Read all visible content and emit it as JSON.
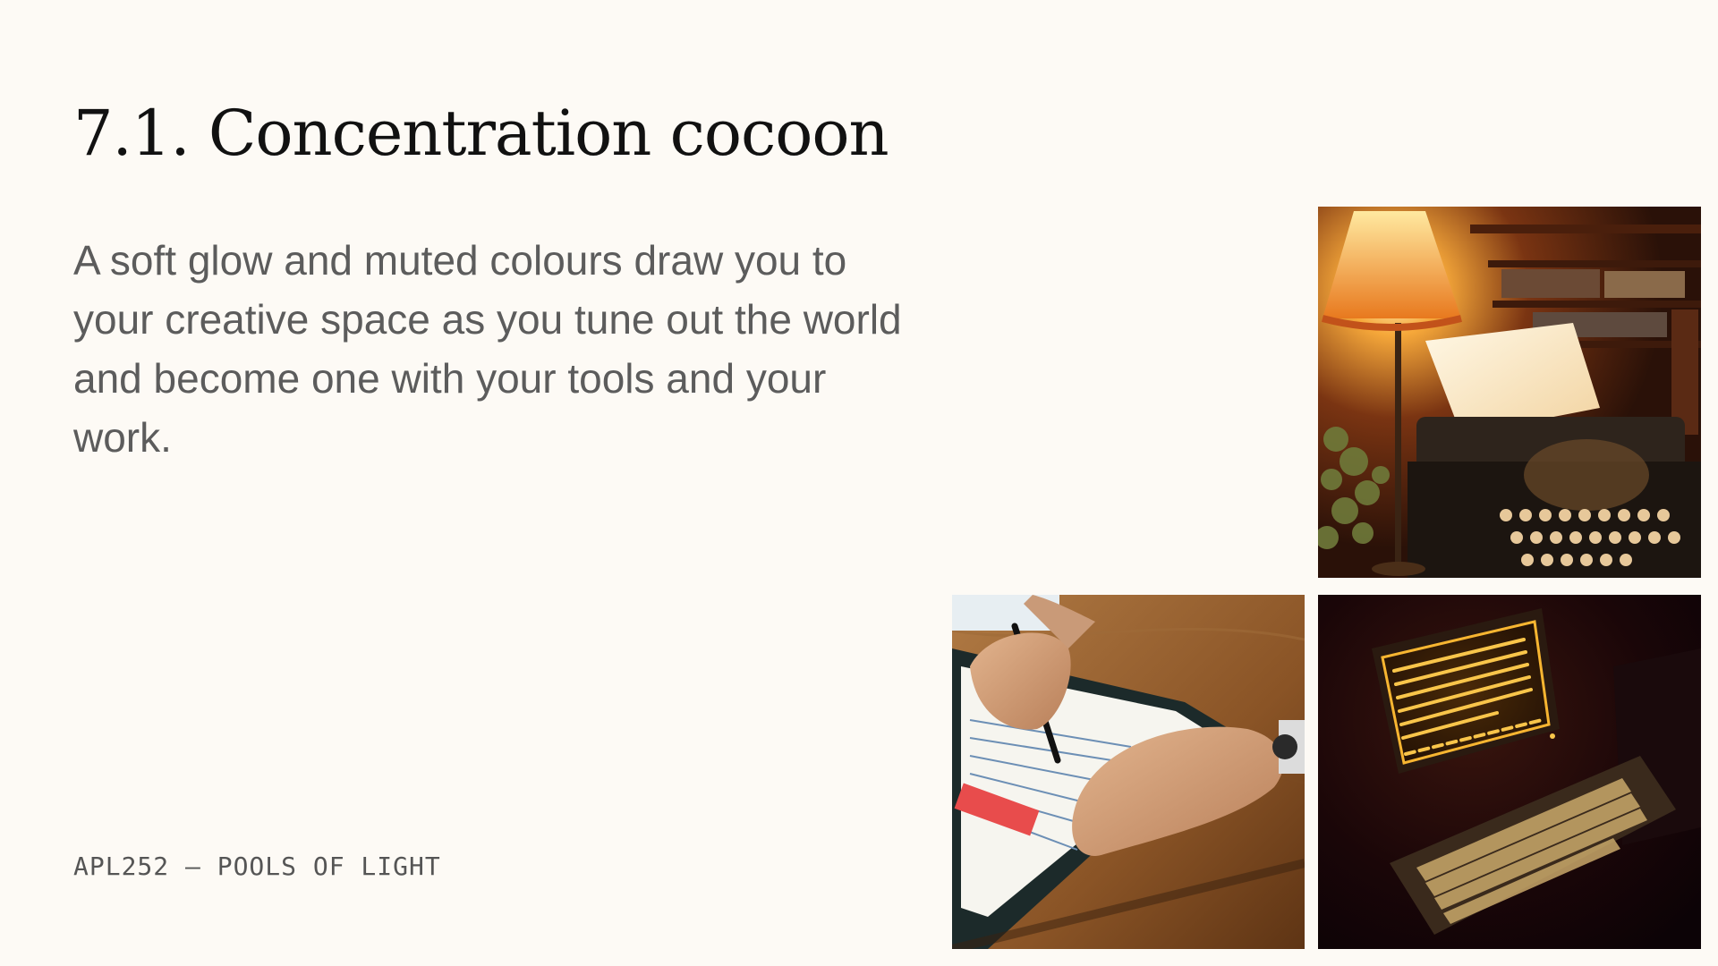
{
  "slide": {
    "title": "7.1. Concentration cocoon",
    "body": "A soft glow and muted colours draw you to your creative space as you tune out the world and become one with your tools and your work.",
    "footer": "APL252 – POOLS OF LIGHT"
  },
  "photos": [
    {
      "name": "lamp-typewriter-photo",
      "icon": "lamp-and-typewriter"
    },
    {
      "name": "handwriting-notebook-photo",
      "icon": "hands-writing-in-notebook"
    },
    {
      "name": "glowing-terminal-photo",
      "icon": "amber-crt-terminal"
    }
  ],
  "colors": {
    "background": "#fdfaf5",
    "title": "#111111",
    "body": "#5c5c5c",
    "amber": "#f5a623"
  }
}
